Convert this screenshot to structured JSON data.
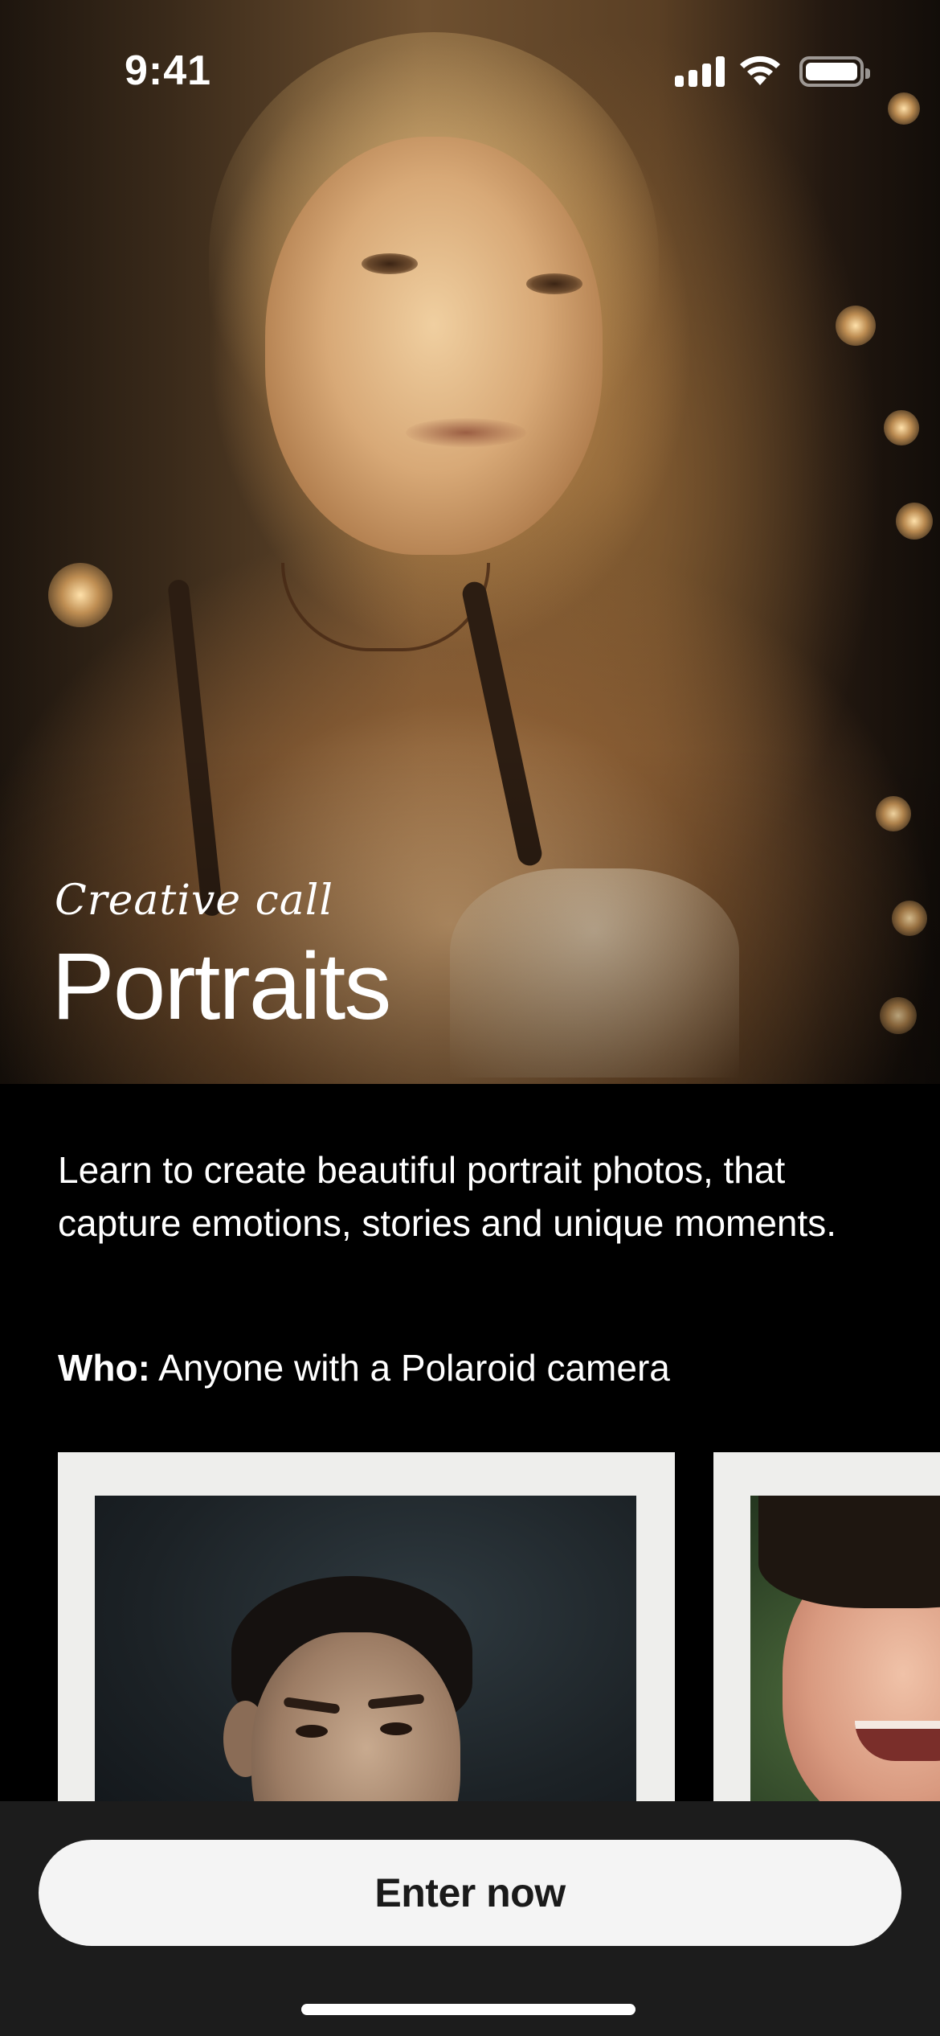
{
  "status_bar": {
    "time": "9:41"
  },
  "hero": {
    "kicker": "Creative call",
    "title": "Portraits"
  },
  "content": {
    "description": "Learn to create beautiful portrait photos, that capture emotions, stories and unique moments.",
    "who_label": "Who:",
    "who_value": " Anyone with a Polaroid camera"
  },
  "cta": {
    "label": "Enter now"
  },
  "colors": {
    "background": "#000000",
    "bottom_bar": "#1c1c1c",
    "button": "#f4f4f4",
    "button_text": "#1a1a1a",
    "polaroid_frame": "#eeeeec"
  },
  "icons": [
    "signal-icon",
    "wifi-icon",
    "battery-icon"
  ]
}
